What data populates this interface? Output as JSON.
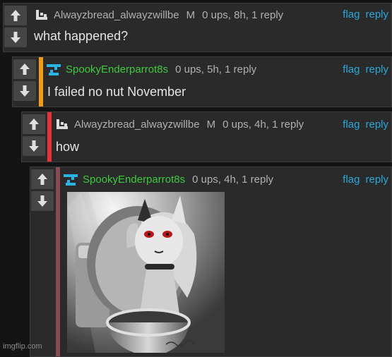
{
  "comments": [
    {
      "username": "Alwayzbread_alwayzwillbe",
      "badge": "M",
      "meta": "0 ups, 8h, 1 reply",
      "text": "what happened?",
      "flag_label": "flag",
      "reply_label": "reply",
      "avatar_icon": "pixel-letter-avatar-icon"
    },
    {
      "username": "SpookyEnderparrot8s",
      "meta": "0 ups, 5h, 1 reply",
      "text": "I failed no nut November",
      "flag_label": "flag",
      "reply_label": "reply",
      "avatar_icon": "pixel-blue-avatar-icon",
      "stripe_color": "#f39c12"
    },
    {
      "username": "Alwayzbread_alwayzwillbe",
      "badge": "M",
      "meta": "0 ups, 4h, 1 reply",
      "text": "how",
      "flag_label": "flag",
      "reply_label": "reply",
      "avatar_icon": "pixel-letter-avatar-icon",
      "stripe_color": "#e8323a"
    },
    {
      "username": "SpookyEnderparrot8s",
      "meta": "0 ups, 4h, 1 reply",
      "flag_label": "flag",
      "reply_label": "reply",
      "avatar_icon": "pixel-blue-avatar-icon",
      "stripe_color": "#8a4a52",
      "image_description_icon": "toilet-character-meme-image"
    }
  ],
  "watermark": "imgflip.com",
  "colors": {
    "link": "#2aa8d8",
    "username_green": "#3ec93e",
    "background": "#141414",
    "panel": "#2a2a2a"
  }
}
